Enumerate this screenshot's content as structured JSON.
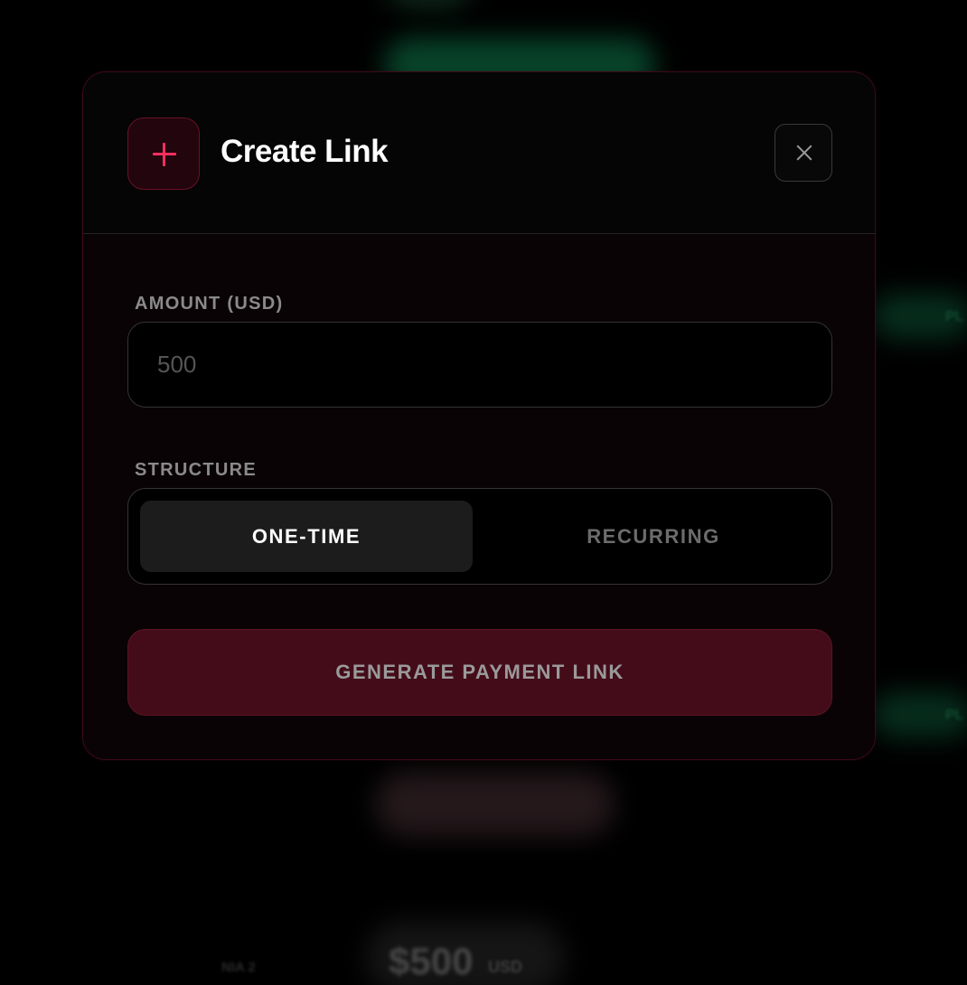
{
  "modal": {
    "title": "Create Link",
    "icon": "plus-icon",
    "close_icon": "close-icon"
  },
  "form": {
    "amount_label": "AMOUNT (USD)",
    "amount_placeholder": "500",
    "amount_value": "",
    "structure_label": "STRUCTURE",
    "structure_options": [
      "ONE-TIME",
      "RECURRING"
    ],
    "structure_selected": "ONE-TIME",
    "submit_label": "GENERATE PAYMENT LINK"
  },
  "background": {
    "amount_text": "$500",
    "currency_text": "USD",
    "left_text": "NIA 2",
    "pill_text_1": "PL",
    "pill_text_2": "PL"
  },
  "colors": {
    "accent": "#ff2f5e",
    "submit_bg": "#440c19",
    "modal_bg": "#060304"
  }
}
